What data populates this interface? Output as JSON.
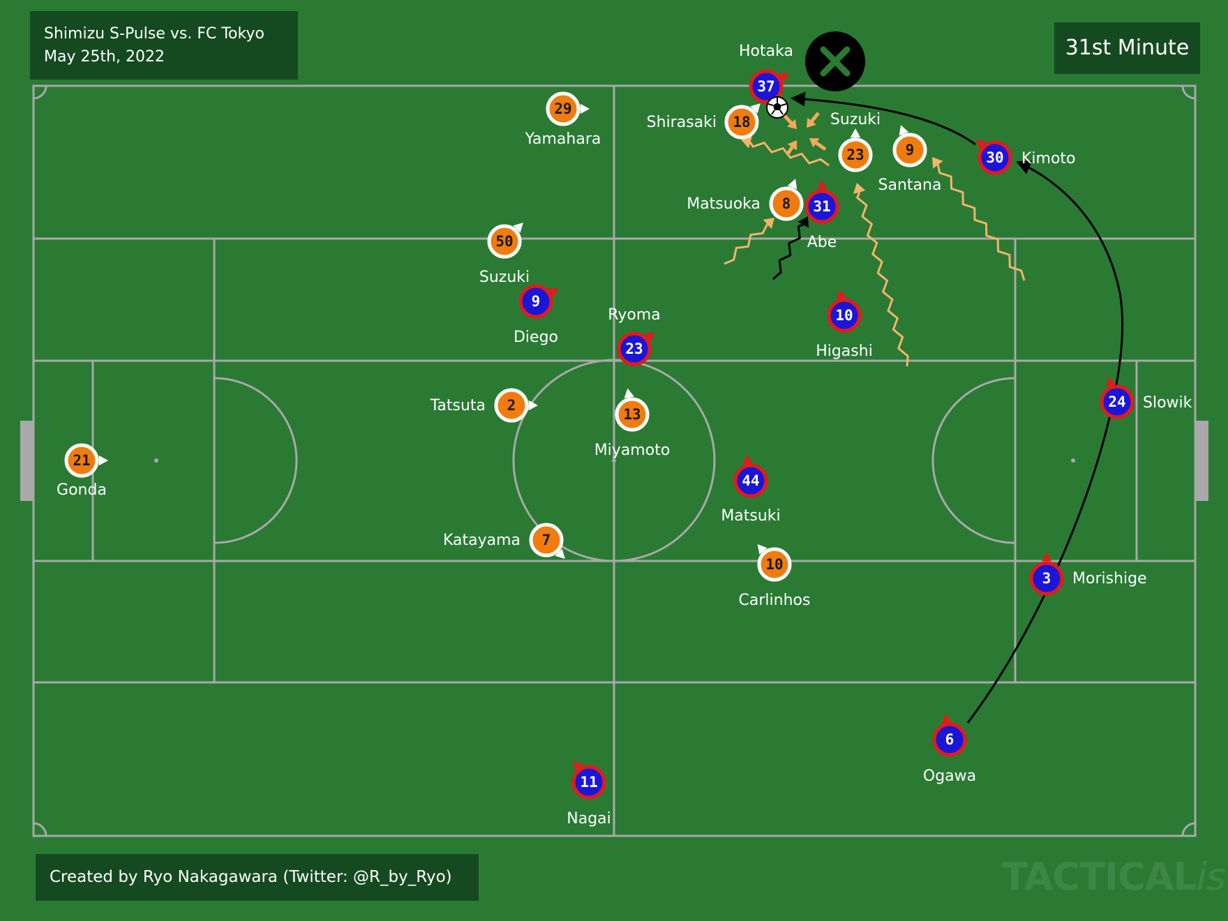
{
  "match": {
    "title_line1": "Shimizu S-Pulse vs. FC Tokyo",
    "title_line2": "May 25th, 2022"
  },
  "minute_label": "31st Minute",
  "credit": "Created by Ryo Nakagawara (Twitter: @R_by_Ryo)",
  "watermark": {
    "main": "TACTICAL",
    "suffix": "ista"
  },
  "colors": {
    "pitch": "#2a7a34",
    "lines": "#a9a9a9",
    "shimizu_fill": "#f07c10",
    "shimizu_ring": "#ffffff",
    "tokyo_fill": "#1a16d8",
    "tokyo_ring": "#e21b1b",
    "wavy_run": "#f4b46a",
    "press_arrow": "#f6a95b"
  },
  "players": {
    "shimizu": [
      {
        "num": "21",
        "name": "Gonda"
      },
      {
        "num": "29",
        "name": "Yamahara"
      },
      {
        "num": "18",
        "name": "Shirasaki"
      },
      {
        "num": "23",
        "name": "Suzuki"
      },
      {
        "num": "9",
        "name": "Santana"
      },
      {
        "num": "8",
        "name": "Matsuoka"
      },
      {
        "num": "50",
        "name": "Suzuki"
      },
      {
        "num": "2",
        "name": "Tatsuta"
      },
      {
        "num": "13",
        "name": "Miyamoto"
      },
      {
        "num": "7",
        "name": "Katayama"
      },
      {
        "num": "10",
        "name": "Carlinhos"
      }
    ],
    "tokyo": [
      {
        "num": "37",
        "name": "Hotaka"
      },
      {
        "num": "30",
        "name": "Kimoto"
      },
      {
        "num": "31",
        "name": "Abe"
      },
      {
        "num": "9",
        "name": "Diego"
      },
      {
        "num": "23",
        "name": "Ryoma"
      },
      {
        "num": "10",
        "name": "Higashi"
      },
      {
        "num": "24",
        "name": "Slowik"
      },
      {
        "num": "44",
        "name": "Matsuki"
      },
      {
        "num": "3",
        "name": "Morishige"
      },
      {
        "num": "6",
        "name": "Ogawa"
      },
      {
        "num": "11",
        "name": "Nagai"
      }
    ]
  },
  "events": {
    "lost_ball_marker": "x-icon"
  }
}
